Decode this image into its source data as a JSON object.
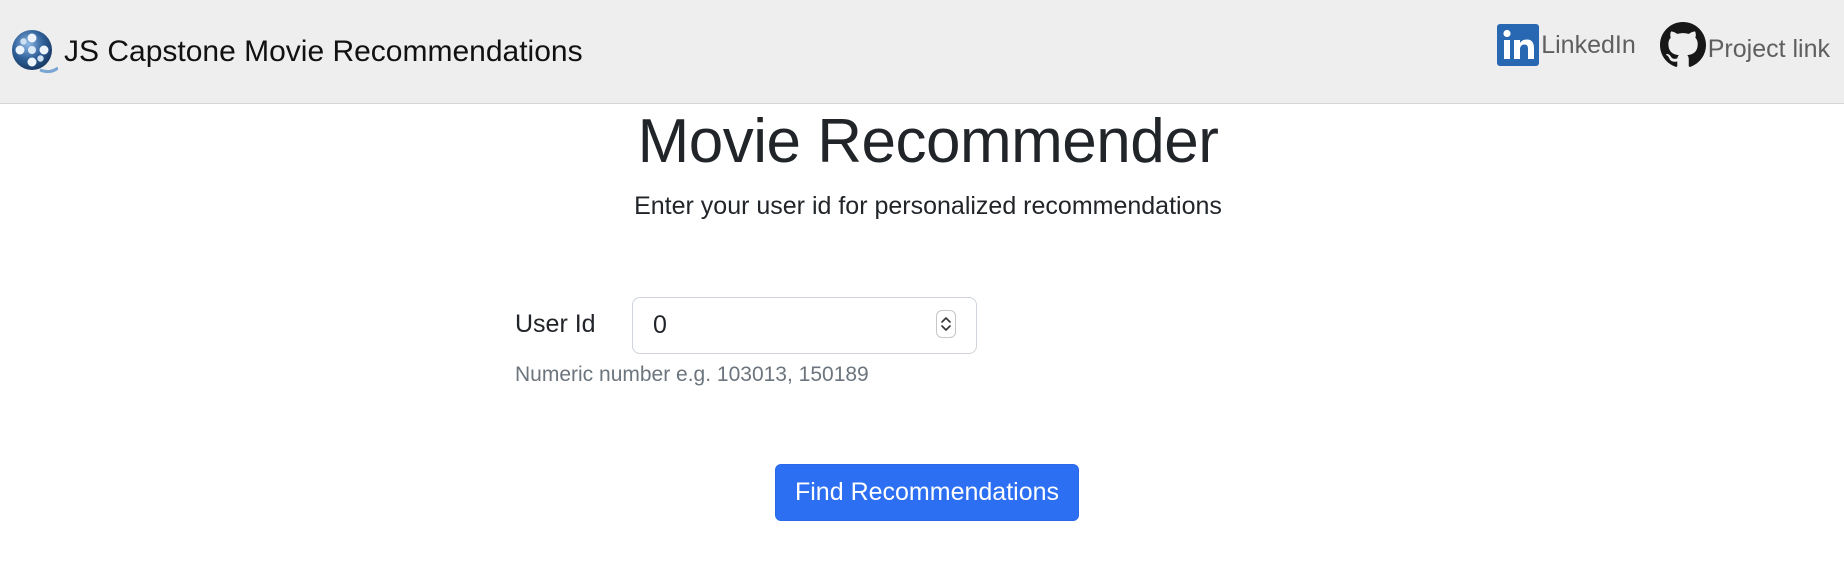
{
  "navbar": {
    "brand_title": "JS Capstone Movie Recommendations",
    "brand_icon": "film-reel-icon",
    "links": [
      {
        "label": "LinkedIn",
        "icon": "linkedin-icon",
        "color": "#2867b2"
      },
      {
        "label": "Project link",
        "icon": "github-icon",
        "color": "#181717"
      }
    ]
  },
  "main": {
    "title": "Movie Recommender",
    "subtitle": "Enter your user id for personalized recommendations"
  },
  "form": {
    "user_id_label": "User Id",
    "user_id_value": "0",
    "help_text": "Numeric number e.g. 103013, 150189",
    "submit_label": "Find Recommendations"
  },
  "colors": {
    "navbar_bg": "#eeeeee",
    "primary": "#2d6ff2"
  }
}
